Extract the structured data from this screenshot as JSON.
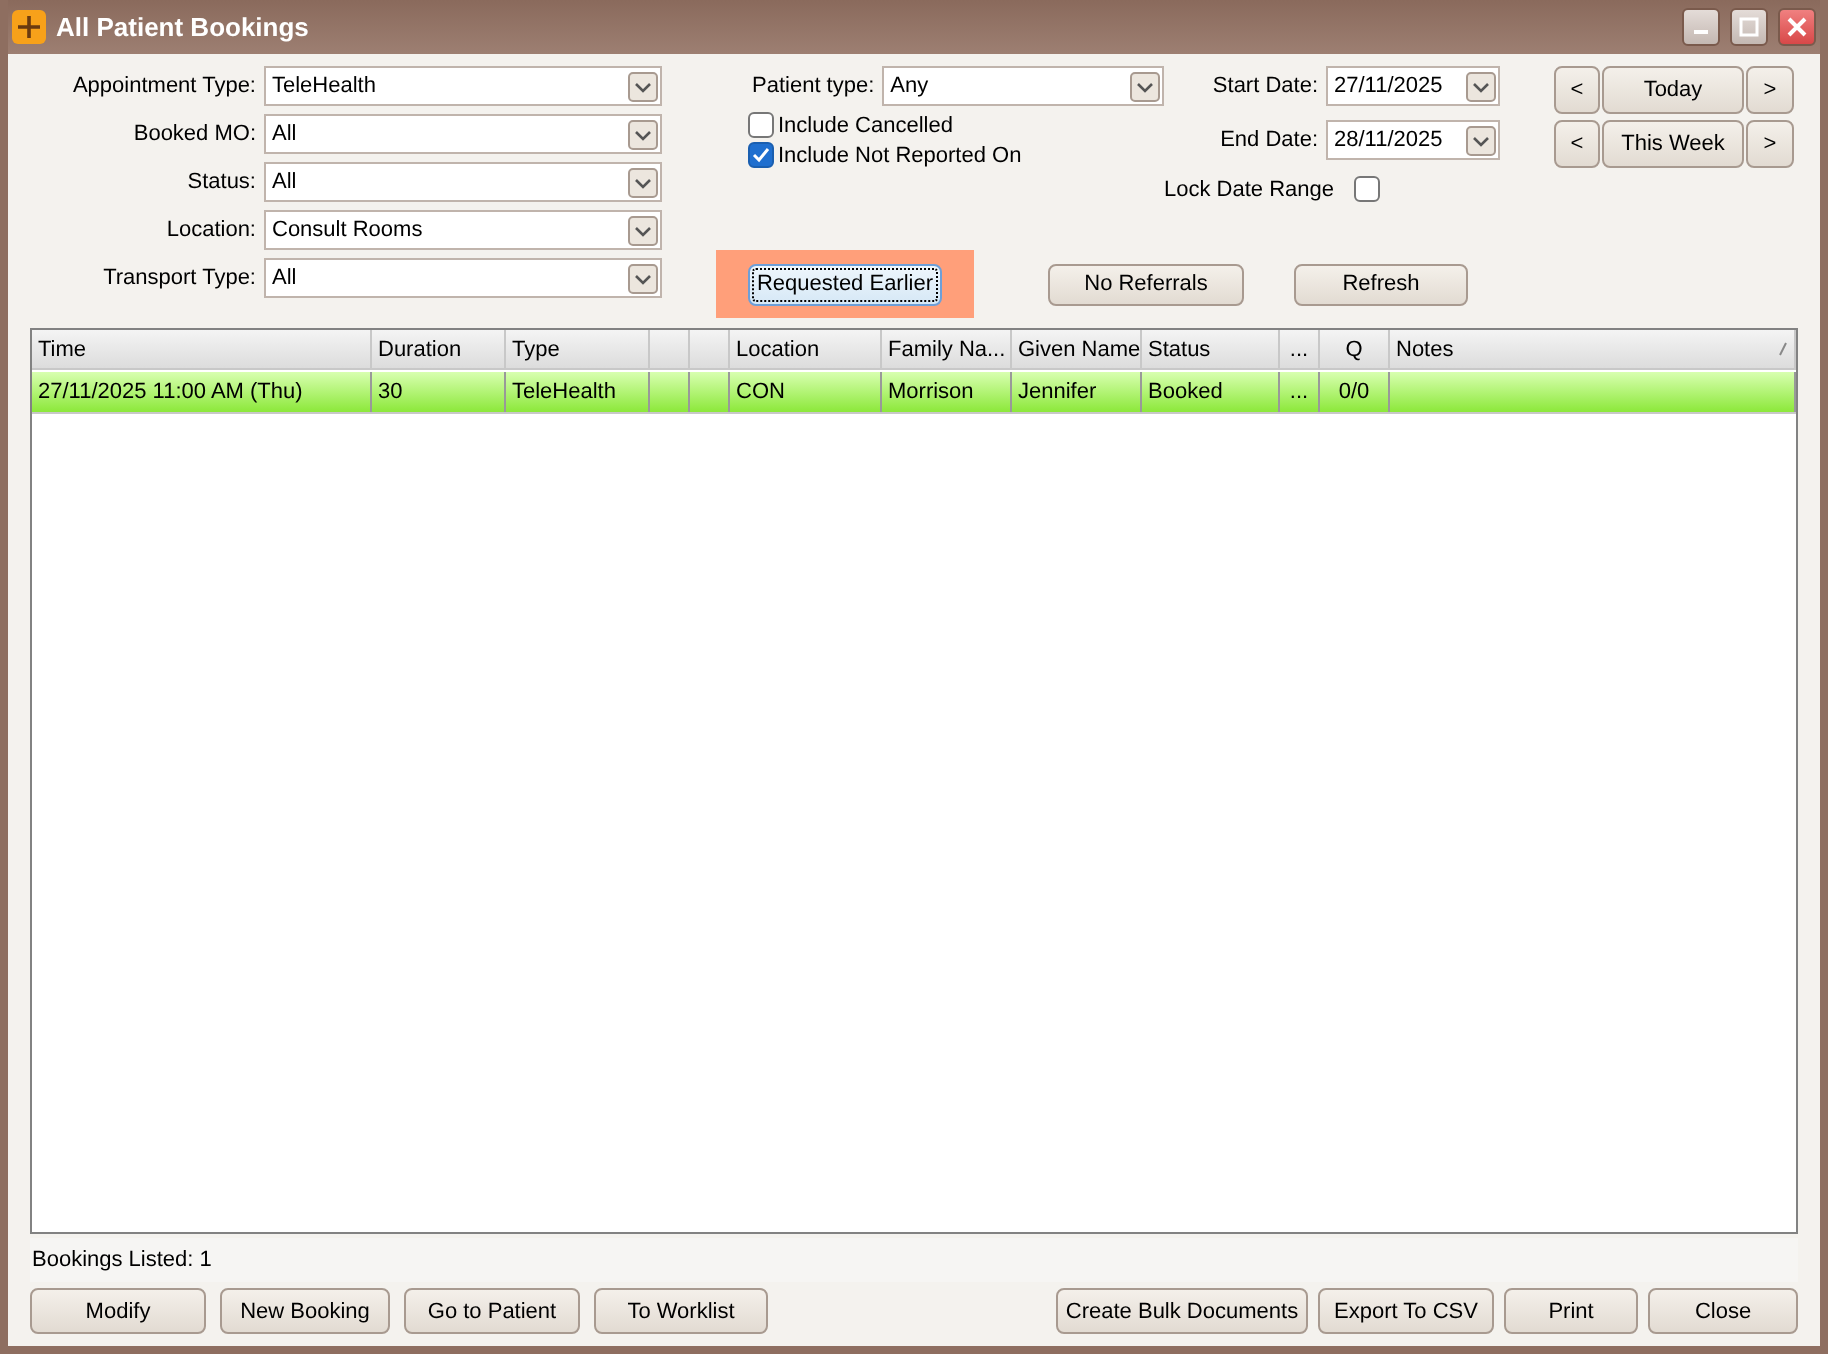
{
  "window": {
    "title": "All Patient Bookings"
  },
  "filters": [
    {
      "label": "Appointment Type:",
      "value": "TeleHealth"
    },
    {
      "label": "Booked MO:",
      "value": "All"
    },
    {
      "label": "Status:",
      "value": "All"
    },
    {
      "label": "Location:",
      "value": "Consult Rooms"
    },
    {
      "label": "Transport Type:",
      "value": "All"
    }
  ],
  "patient_type": {
    "label": "Patient type:",
    "value": "Any"
  },
  "checkboxes": [
    {
      "label": "Include Cancelled",
      "checked": false
    },
    {
      "label": "Include Not Reported On",
      "checked": true
    }
  ],
  "dates": [
    {
      "label": "Start Date:",
      "value": "27/11/2025"
    },
    {
      "label": "End Date:",
      "value": "28/11/2025"
    }
  ],
  "lock_date_range": {
    "label": "Lock Date Range",
    "checked": false
  },
  "navigators": [
    {
      "prev": "<",
      "label": "Today",
      "next": ">"
    },
    {
      "prev": "<",
      "label": "This Week",
      "next": ">"
    }
  ],
  "filter_buttons": [
    {
      "label": "Requested Earlier",
      "highlighted": true
    },
    {
      "label": "No Referrals",
      "highlighted": false
    },
    {
      "label": "Refresh",
      "highlighted": false
    }
  ],
  "table": {
    "columns": [
      {
        "label": "Time"
      },
      {
        "label": "Duration"
      },
      {
        "label": "Type"
      },
      {},
      {},
      {
        "label": "Location"
      },
      {
        "label": "Family Na..."
      },
      {
        "label": "Given Name"
      },
      {
        "label": "Status"
      },
      {
        "label": "..."
      },
      {
        "label": "Q"
      },
      {
        "label": "Notes"
      }
    ],
    "rows": [
      {
        "selected": true,
        "cells": [
          "27/11/2025 11:00 AM (Thu)",
          "30",
          "TeleHealth",
          null,
          null,
          "CON",
          "Morrison",
          "Jennifer",
          "Booked",
          "...",
          "0/0",
          null
        ]
      }
    ]
  },
  "status_bar": {
    "text": "Bookings Listed: 1"
  },
  "actions_left": [
    "Modify",
    "New Booking",
    "Go to Patient",
    "To Worklist"
  ],
  "actions_right": [
    "Create Bulk Documents",
    "Export To CSV",
    "Print",
    "Close"
  ]
}
